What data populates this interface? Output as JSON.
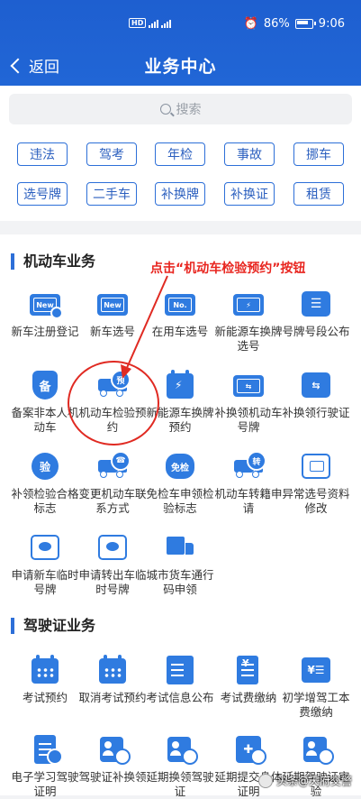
{
  "status": {
    "network": "HD",
    "battery": "86%",
    "time": "9:06"
  },
  "header": {
    "back_label": "返回",
    "title": "业务中心"
  },
  "search": {
    "placeholder": "搜索"
  },
  "quick_chips": [
    "违法",
    "驾考",
    "年检",
    "事故",
    "挪车",
    "选号牌",
    "二手车",
    "补换牌",
    "补换证",
    "租赁"
  ],
  "section_vehicle": {
    "title": "机动车业务",
    "items": [
      {
        "label": "新车注册登记",
        "icon": "new-plate-check-icon"
      },
      {
        "label": "新车选号",
        "icon": "new-plate-icon"
      },
      {
        "label": "在用车选号",
        "icon": "number-plate-icon"
      },
      {
        "label": "新能源车换牌选号",
        "icon": "ev-plate-icon"
      },
      {
        "label": "号牌号段公布",
        "icon": "announcement-icon"
      },
      {
        "label": "备案非本人机动车",
        "icon": "shield-icon"
      },
      {
        "label": "机动车检验预约",
        "icon": "truck-appointment-icon"
      },
      {
        "label": "新能源车换牌预约",
        "icon": "ev-calendar-icon"
      },
      {
        "label": "补换领机动车号牌",
        "icon": "plate-exchange-icon"
      },
      {
        "label": "补换领行驶证",
        "icon": "license-exchange-icon"
      },
      {
        "label": "补领检验合格标志",
        "icon": "inspection-badge-icon"
      },
      {
        "label": "变更机动车联系方式",
        "icon": "truck-phone-icon"
      },
      {
        "label": "免检车申领检验标志",
        "icon": "exempt-badge-icon"
      },
      {
        "label": "机动车转籍申请",
        "icon": "truck-transfer-icon"
      },
      {
        "label": "异常选号资料修改",
        "icon": "edit-plate-icon"
      },
      {
        "label": "申请新车临时号牌",
        "icon": "temp-plate-icon"
      },
      {
        "label": "申请转出车临时号牌",
        "icon": "temp-plate-out-icon"
      },
      {
        "label": "城市货车通行码申领",
        "icon": "cargo-truck-icon"
      }
    ]
  },
  "section_license": {
    "title": "驾驶证业务",
    "items": [
      {
        "label": "考试预约",
        "icon": "calendar-icon"
      },
      {
        "label": "取消考试预约",
        "icon": "calendar-cancel-icon"
      },
      {
        "label": "考试信息公布",
        "icon": "info-board-icon"
      },
      {
        "label": "考试费缴纳",
        "icon": "fee-icon"
      },
      {
        "label": "初学增驾工本费缴纳",
        "icon": "money-list-icon"
      },
      {
        "label": "电子学习驾驶证明",
        "icon": "e-learning-icon"
      },
      {
        "label": "驾驶证补换领",
        "icon": "license-renew-icon"
      },
      {
        "label": "延期换领驾驶证",
        "icon": "license-delay-icon"
      },
      {
        "label": "延期提交身体证明",
        "icon": "medical-delay-icon"
      },
      {
        "label": "延期驾驶证审验",
        "icon": "license-review-icon"
      }
    ]
  },
  "annotation": {
    "text": "点击“机动车检验预约”按钮"
  },
  "watermark": {
    "text": "头条@天府交警"
  },
  "colors": {
    "primary": "#2166d6",
    "accent_red": "#e8251f"
  }
}
